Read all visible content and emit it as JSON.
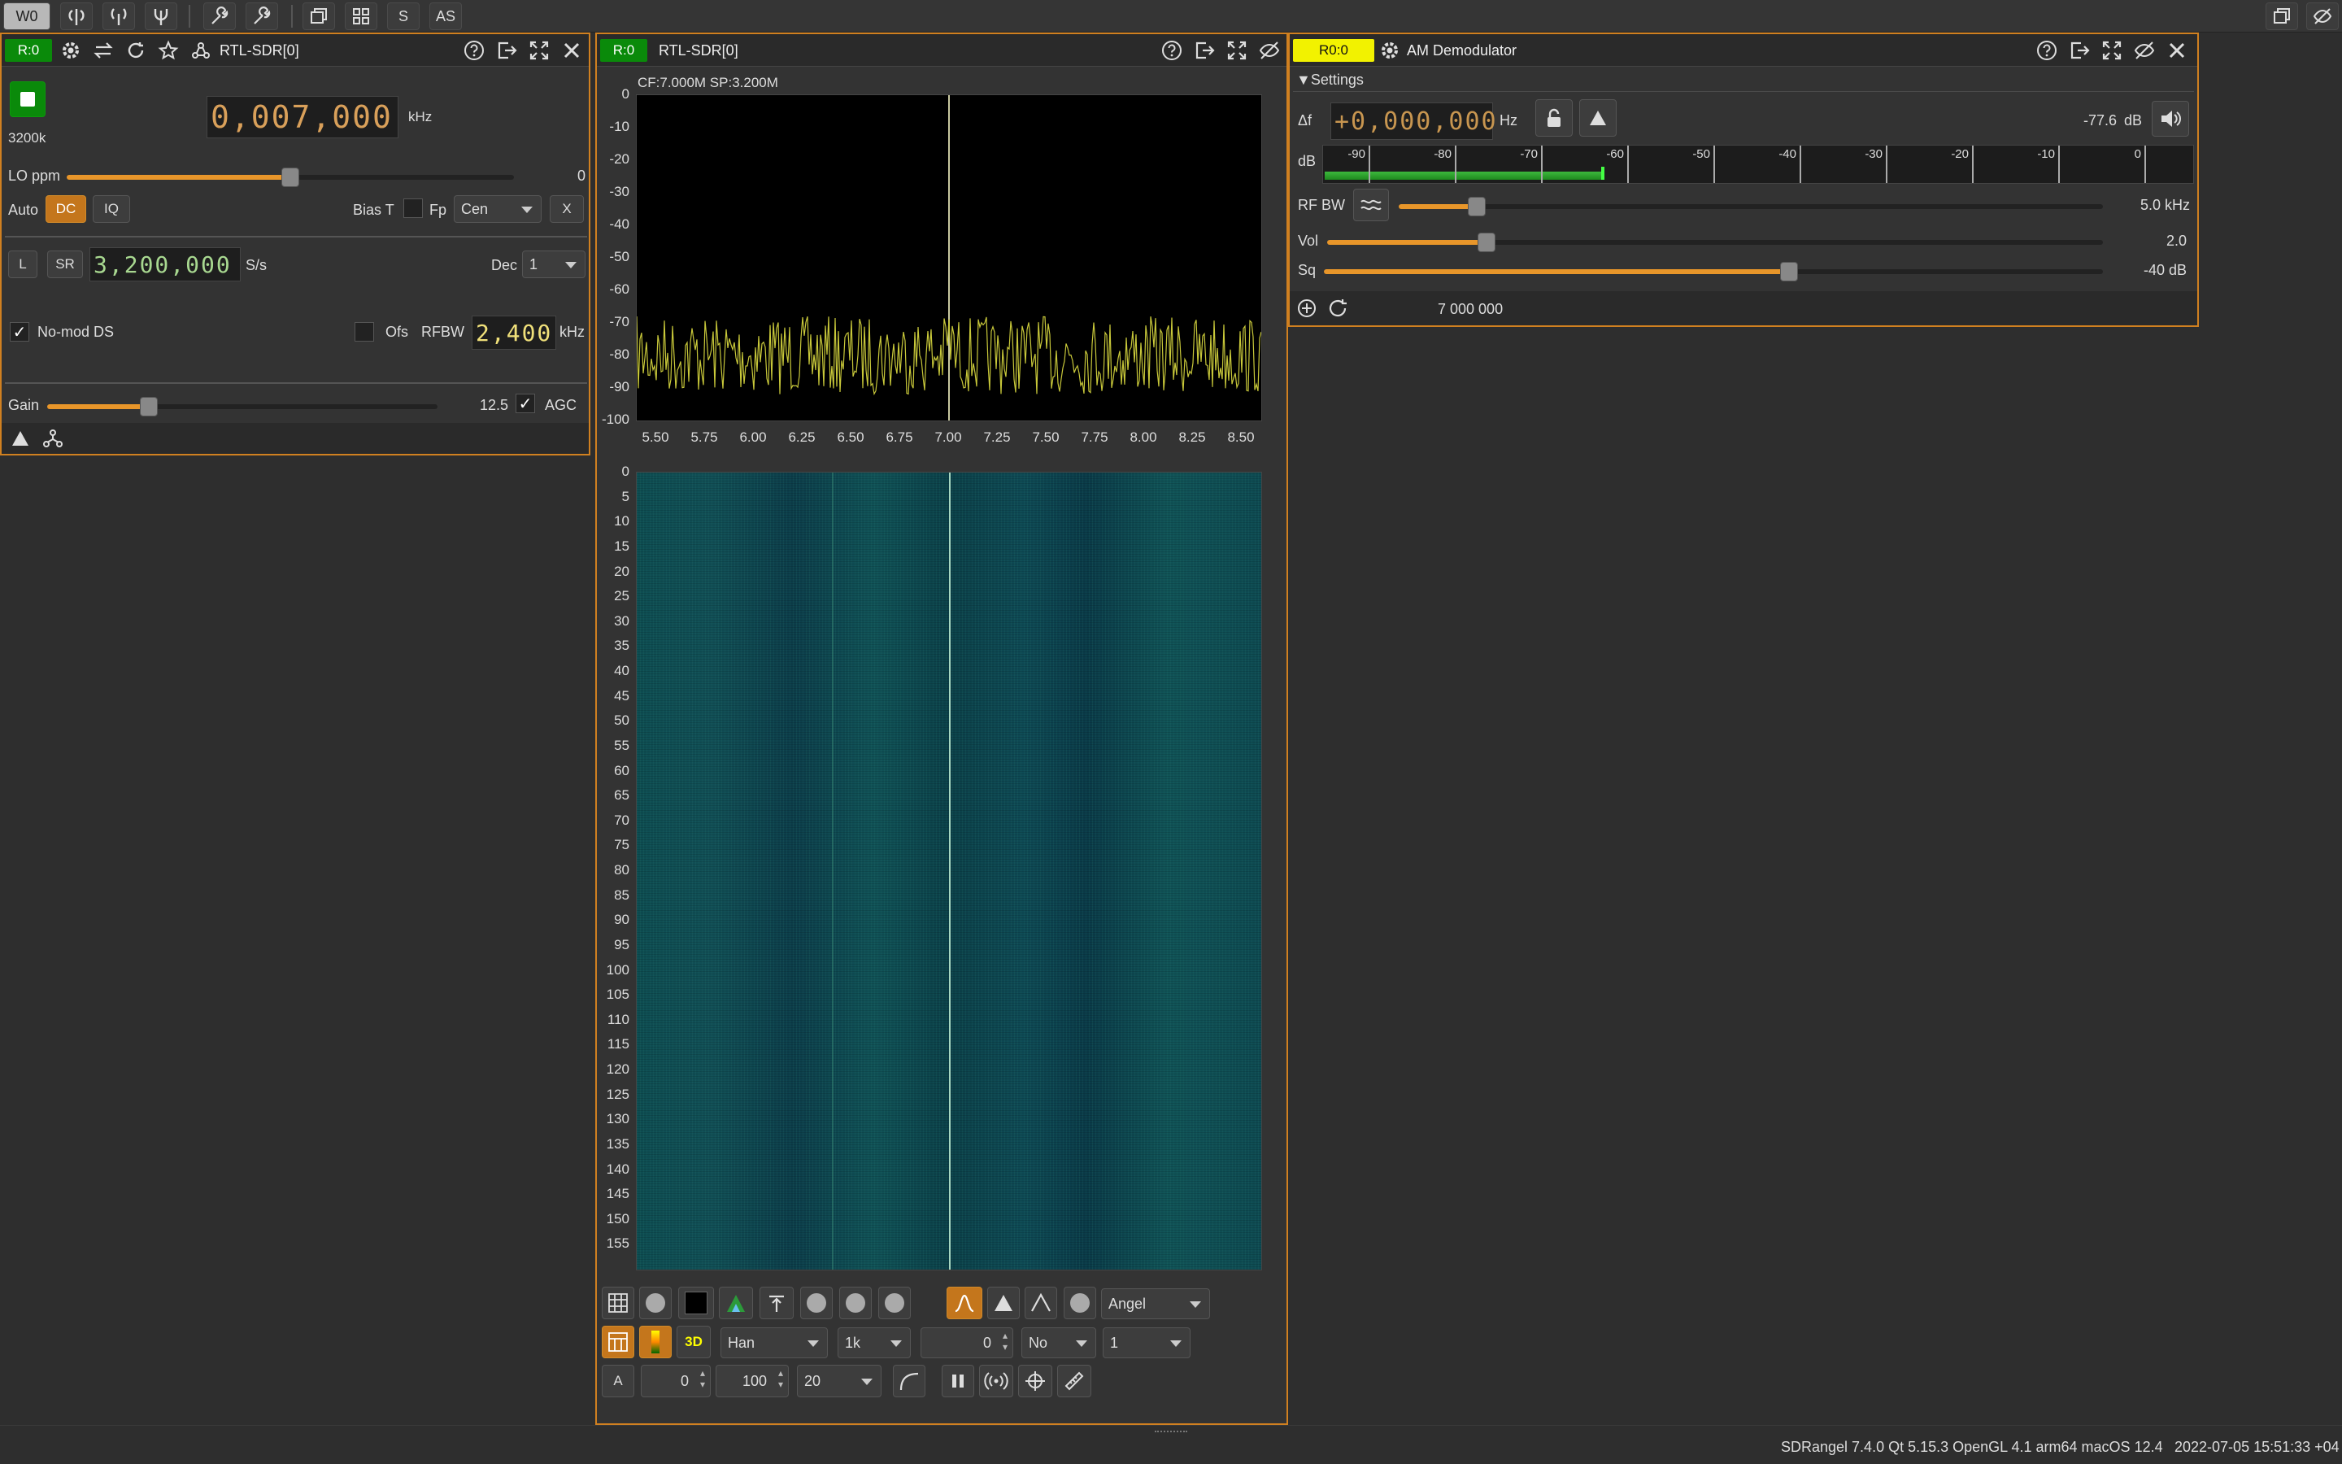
{
  "toolbar": {
    "w0": "W0",
    "s": "S",
    "as": "AS",
    "icons": [
      "add-rx-icon",
      "add-tx-icon",
      "add-mimo-icon",
      "add-feature-icon",
      "load-config-icon",
      "save-config-icon",
      "new-workspace-icon",
      "tile-icon"
    ]
  },
  "device_panel": {
    "badge": "R:0",
    "title": "RTL-SDR[0]",
    "sr_label": "3200k",
    "freq_digits": "0,007,000",
    "freq_unit": "kHz",
    "lo_ppm_label": "LO ppm",
    "lo_ppm_value": "0",
    "auto_label": "Auto",
    "dc_label": "DC",
    "iq_label": "IQ",
    "biast_label": "Bias T",
    "fp_label": "Fp",
    "fp_select": "Cen",
    "x_label": "X",
    "l_label": "L",
    "sr_btn": "SR",
    "samplerate_digits": "3,200,000",
    "samplerate_unit": "S/s",
    "dec_label": "Dec",
    "dec_value": "1",
    "nomod_label": "No-mod DS",
    "ofs_label": "Ofs",
    "rfbw_label": "RFBW",
    "rfbw_digits": "2,400",
    "rfbw_unit": "kHz",
    "gain_label": "Gain",
    "gain_value": "12.5",
    "agc_label": "AGC",
    "lo_ppm_fraction": 0.5,
    "gain_fraction": 0.26
  },
  "spectrum_panel": {
    "badge": "R:0",
    "title": "RTL-SDR[0]",
    "info": "CF:7.000M SP:3.200M",
    "y_ticks": [
      "0",
      "-10",
      "-20",
      "-30",
      "-40",
      "-50",
      "-60",
      "-70",
      "-80",
      "-90",
      "-100"
    ],
    "x_ticks": [
      "5.50",
      "5.75",
      "6.00",
      "6.25",
      "6.50",
      "6.75",
      "7.00",
      "7.25",
      "7.50",
      "7.75",
      "8.00",
      "8.25",
      "8.50"
    ],
    "wf_ticks": [
      "0",
      "5",
      "10",
      "15",
      "20",
      "25",
      "30",
      "35",
      "40",
      "45",
      "50",
      "55",
      "60",
      "65",
      "70",
      "75",
      "80",
      "85",
      "90",
      "95",
      "100",
      "105",
      "110",
      "115",
      "120",
      "125",
      "130",
      "135",
      "140",
      "145",
      "150",
      "155"
    ],
    "palette": "Angel",
    "window": "Han",
    "fft_size": "1k",
    "ref_spin": "0",
    "avg_mode": "No",
    "avg_value": "1",
    "a_label": "A",
    "ref_level": "0",
    "range": "100",
    "fps": "20",
    "trace_color": "#c8c83a",
    "wf_color": "#0f5a5a"
  },
  "am_panel": {
    "badge": "R0:0",
    "title": "AM Demodulator",
    "settings_label": "Settings",
    "delta_f_label": "Δf",
    "delta_digits": "+0,000,000",
    "hz": "Hz",
    "level": "-77.6",
    "db_unit": "dB",
    "db_label": "dB",
    "meter_ticks": [
      "-90",
      "-80",
      "-70",
      "-60",
      "-50",
      "-40",
      "-30",
      "-20",
      "-10",
      "0"
    ],
    "rfbw_label": "RF BW",
    "rfbw_value": "5.0 kHz",
    "vol_label": "Vol",
    "vol_value": "2.0",
    "sq_label": "Sq",
    "sq_value": "-40 dB",
    "freq_display": "7 000 000",
    "rfbw_fraction": 0.1,
    "vol_fraction": 0.2,
    "sq_fraction": 0.6,
    "meter_level_fraction": 0.32
  },
  "status": {
    "text": "SDRangel 7.4.0 Qt 5.15.3 OpenGL 4.1 arm64 macOS 12.4",
    "datetime": "2022-07-05 15:51:33 +04"
  }
}
